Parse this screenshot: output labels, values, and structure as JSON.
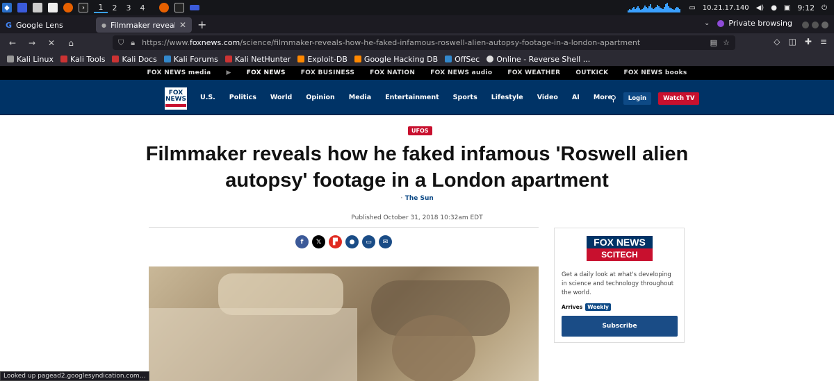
{
  "taskbar": {
    "workspaces": [
      "1",
      "2",
      "3",
      "4"
    ],
    "ip": "10.21.17.140",
    "time": "9:12"
  },
  "tabs": [
    {
      "label": "Google Lens"
    },
    {
      "label": "Filmmaker reveals how he"
    }
  ],
  "private_label": "Private browsing",
  "url": {
    "prefix": "https://www.",
    "domain": "foxnews.com",
    "path": "/science/filmmaker-reveals-how-he-faked-infamous-roswell-alien-autopsy-footage-in-a-london-apartment"
  },
  "bookmarks": [
    "Kali Linux",
    "Kali Tools",
    "Kali Docs",
    "Kali Forums",
    "Kali NetHunter",
    "Exploit-DB",
    "Google Hacking DB",
    "OffSec",
    "Online - Reverse Shell ..."
  ],
  "fox_network": [
    "FOX NEWS media",
    "FOX NEWS",
    "FOX BUSINESS",
    "FOX NATION",
    "FOX NEWS audio",
    "FOX WEATHER",
    "OUTKICK",
    "FOX NEWS books"
  ],
  "fox_nav": {
    "items": [
      "U.S.",
      "Politics",
      "World",
      "Opinion",
      "Media",
      "Entertainment",
      "Sports",
      "Lifestyle",
      "Video",
      "AI",
      "More"
    ],
    "login": "Login",
    "watch": "Watch TV"
  },
  "article": {
    "category": "UFOS",
    "headline": "Filmmaker reveals how he faked infamous 'Roswell alien autopsy' footage in a London apartment",
    "author": "The Sun",
    "published": "Published October 31, 2018 10:32am EDT"
  },
  "newsletter": {
    "logo_top": "FOX NEWS",
    "logo_bottom": "SCITECH",
    "description": "Get a daily look at what's developing in science and technology throughout the world.",
    "arrives_label": "Arrives",
    "frequency": "Weekly",
    "subscribe": "Subscribe"
  },
  "status_text": "Looked up pagead2.googlesyndication.com…",
  "colors": {
    "fox_blue": "#003366",
    "fox_red": "#c8102e"
  }
}
